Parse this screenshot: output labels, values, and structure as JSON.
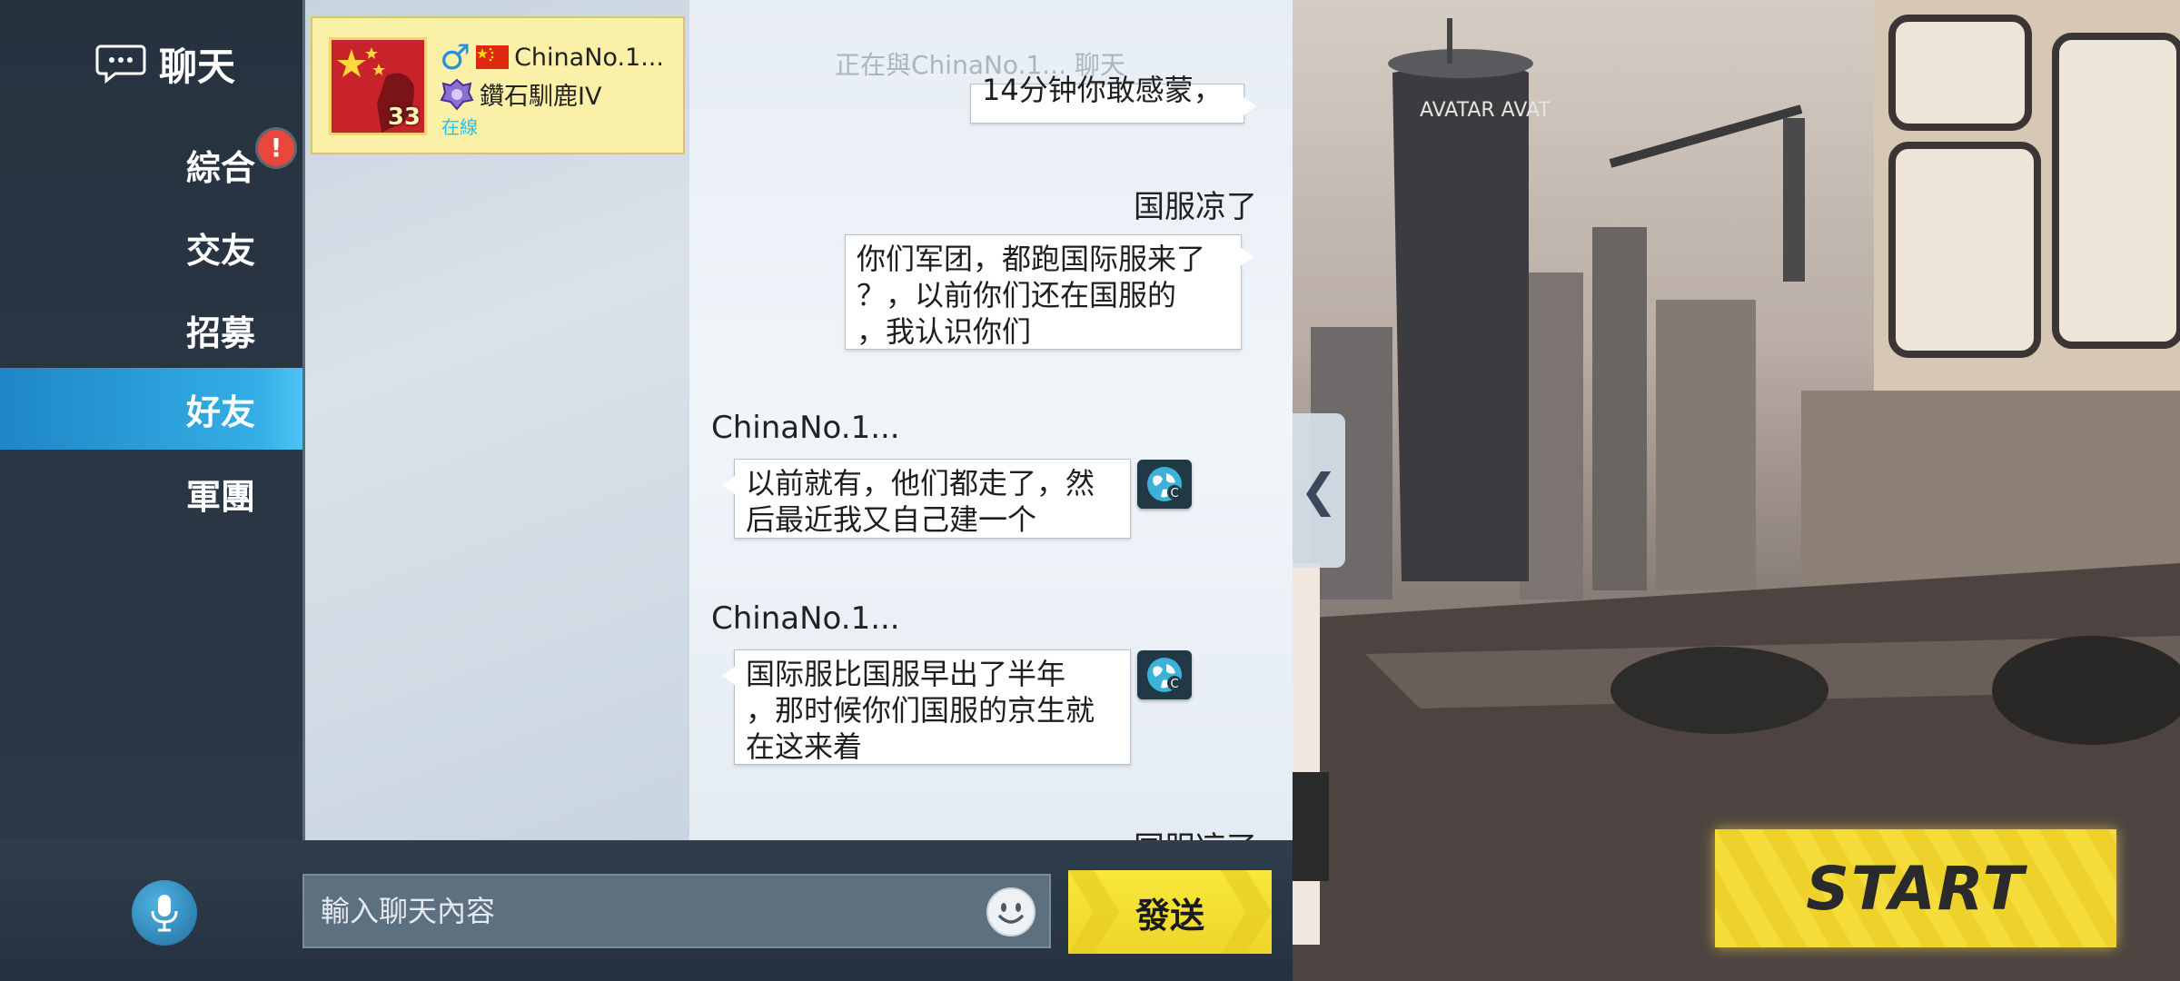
{
  "sidebar": {
    "title": "聊天",
    "items": [
      {
        "label": "綜合",
        "badge": "!"
      },
      {
        "label": "交友"
      },
      {
        "label": "招募"
      },
      {
        "label": "好友",
        "active": true
      },
      {
        "label": "軍團"
      }
    ]
  },
  "friend": {
    "level": "33",
    "gender_symbol": "♂",
    "name": "ChinaNo.1...",
    "rank": "鑽石馴鹿IV",
    "status": "在線"
  },
  "chat": {
    "with_label": "正在與ChinaNo.1... 聊天",
    "messages": [
      {
        "side": "right",
        "text": "14分钟你敢感蒙，"
      },
      {
        "side": "right",
        "sender": "国服凉了",
        "lines": [
          "你们军团，都跑国际服来了",
          "？，以前你们还在国服的",
          "，我认识你们"
        ]
      },
      {
        "side": "left",
        "sender": "ChinaNo.1...",
        "lines": [
          "以前就有，他们都走了，然",
          "后最近我又自己建一个"
        ]
      },
      {
        "side": "left",
        "sender": "ChinaNo.1...",
        "lines": [
          "国际服比国服早出了半年",
          "，那时候你们国服的京生就",
          "在这来着"
        ]
      },
      {
        "side": "right",
        "sender": "国服凉了"
      }
    ]
  },
  "input": {
    "placeholder": "輸入聊天內容",
    "send_label": "發送"
  },
  "scene": {
    "start_label": "START",
    "collapse_glyph": "❮"
  },
  "colors": {
    "accent_blue": "#33aee6",
    "friend_card": "#fbf0a7",
    "send_yellow": "#f4e235",
    "alert_red": "#e8483b"
  }
}
